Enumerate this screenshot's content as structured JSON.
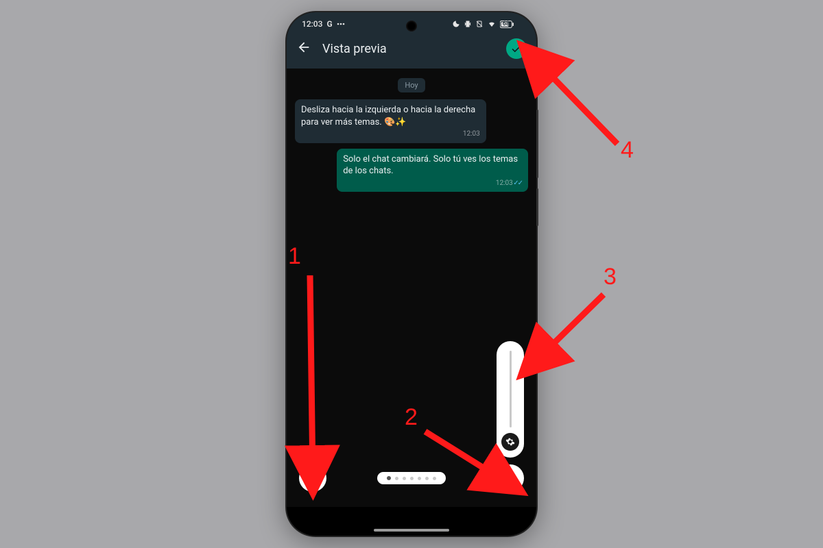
{
  "status": {
    "time": "12:03",
    "app_letter": "G",
    "battery": "68"
  },
  "header": {
    "title": "Vista previa"
  },
  "chat": {
    "date_label": "Hoy",
    "msg_in": {
      "text": "Desliza hacia la izquierda o hacia la derecha para ver más temas. 🎨✨",
      "time": "12:03"
    },
    "msg_out": {
      "text": "Solo el chat cambiará. Solo tú ves los temas de los chats.",
      "time": "12:03"
    }
  },
  "annotations": {
    "n1": "1",
    "n2": "2",
    "n3": "3",
    "n4": "4"
  },
  "colors": {
    "accent": "#00a884",
    "arrow": "#ff1a1a",
    "bubble_in": "#1f2c34",
    "bubble_out": "#005c4b"
  }
}
